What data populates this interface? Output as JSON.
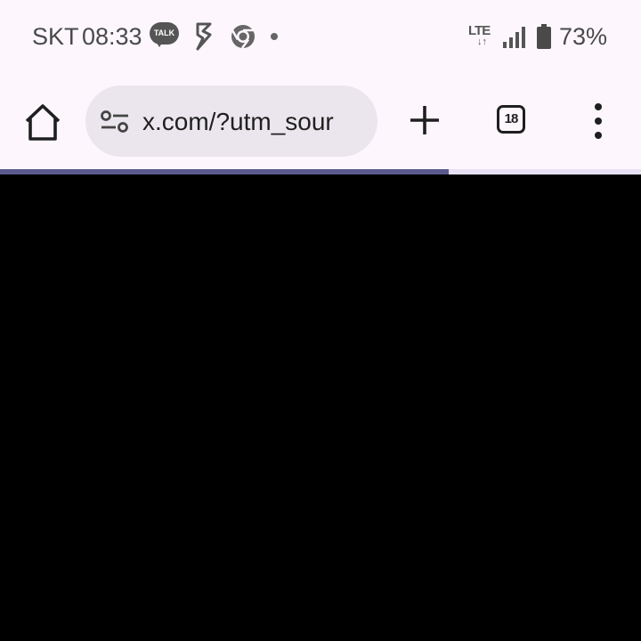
{
  "status_bar": {
    "carrier": "SKT",
    "time": "08:33",
    "notification_icons": [
      "kakaotalk-icon",
      "s-app-icon",
      "chrome-icon",
      "more-notifications-dot"
    ],
    "talk_badge": "TALK",
    "network": "LTE",
    "signal_icon": "signal-icon",
    "battery_icon": "battery-icon",
    "battery": "73%"
  },
  "browser": {
    "url": "x.com/?utm_sour",
    "tab_count": "18",
    "icons": [
      "home-icon",
      "tune-icon",
      "plus-icon",
      "tab-switcher-icon",
      "more-vert-icon"
    ],
    "load_progress": 0.7
  },
  "colors": {
    "chrome_background": "#fdf7fd",
    "url_bar": "#ebe6ee",
    "progress_fill": "#5b5a8e",
    "progress_track": "#e7e0f4",
    "page_background": "#000000"
  }
}
